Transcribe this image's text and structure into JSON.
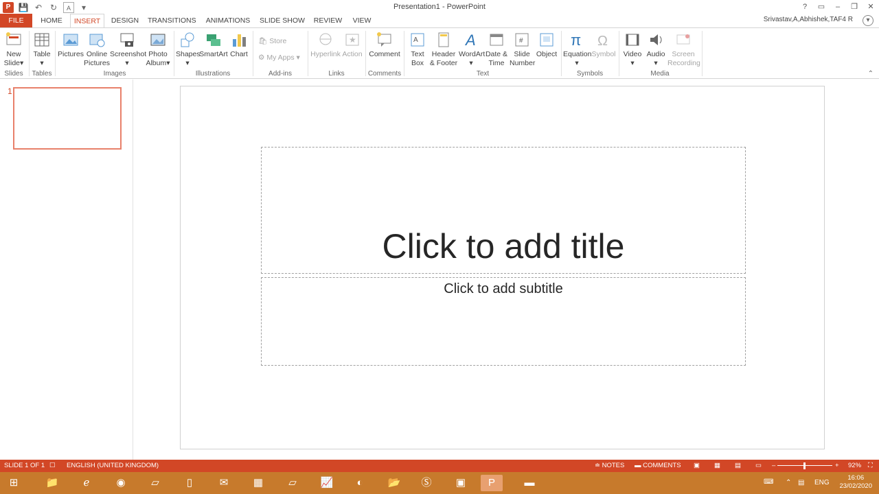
{
  "window": {
    "title": "Presentation1 - PowerPoint",
    "controls": [
      "?",
      "▭",
      "–",
      "❐",
      "✕"
    ]
  },
  "tabs": {
    "file": "FILE",
    "items": [
      "HOME",
      "INSERT",
      "DESIGN",
      "TRANSITIONS",
      "ANIMATIONS",
      "SLIDE SHOW",
      "REVIEW",
      "VIEW"
    ],
    "active": "INSERT",
    "user": "Srivastav,A,Abhishek,TAF4 R"
  },
  "ribbon": {
    "slides": {
      "new_slide_1": "New",
      "new_slide_2": "Slide",
      "label": "Slides"
    },
    "tables": {
      "table": "Table",
      "label": "Tables"
    },
    "images": {
      "pictures": "Pictures",
      "online_1": "Online",
      "online_2": "Pictures",
      "screenshot": "Screenshot",
      "photo_1": "Photo",
      "photo_2": "Album",
      "label": "Images"
    },
    "illustrations": {
      "shapes": "Shapes",
      "smartart": "SmartArt",
      "chart": "Chart",
      "label": "Illustrations"
    },
    "addins": {
      "store": "Store",
      "myapps": "My Apps",
      "label": "Add-ins"
    },
    "links": {
      "hyperlink": "Hyperlink",
      "action": "Action",
      "label": "Links"
    },
    "comments": {
      "comment": "Comment",
      "label": "Comments"
    },
    "text": {
      "textbox_1": "Text",
      "textbox_2": "Box",
      "header_1": "Header",
      "header_2": "& Footer",
      "wordart": "WordArt",
      "date_1": "Date &",
      "date_2": "Time",
      "slidenum_1": "Slide",
      "slidenum_2": "Number",
      "object": "Object",
      "label": "Text"
    },
    "symbols": {
      "equation": "Equation",
      "symbol": "Symbol",
      "label": "Symbols"
    },
    "media": {
      "video": "Video",
      "audio": "Audio",
      "screen_1": "Screen",
      "screen_2": "Recording",
      "label": "Media"
    }
  },
  "thumbnails": {
    "number": "1"
  },
  "slide": {
    "title_placeholder": "Click to add title",
    "subtitle_placeholder": "Click to add subtitle"
  },
  "status": {
    "slide_count": "SLIDE 1 OF 1",
    "language": "ENGLISH (UNITED KINGDOM)",
    "notes": "NOTES",
    "comments": "COMMENTS",
    "zoom": "92%",
    "zoom_level": 0.92
  },
  "taskbar": {
    "lang": "ENG",
    "time": "16:06",
    "date": "23/02/2020"
  },
  "colors": {
    "accent": "#d24726",
    "taskbar": "#c77a2c"
  }
}
